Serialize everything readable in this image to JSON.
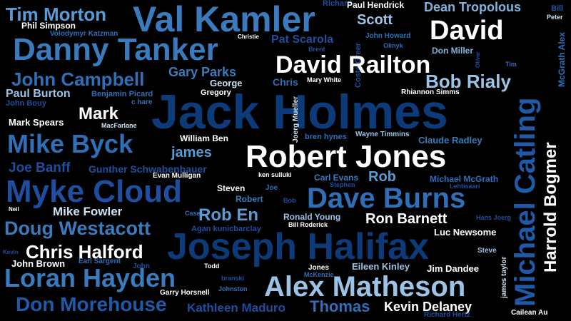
{
  "words": [
    {
      "id": "tim-morton",
      "text": "Tim Morton",
      "color": "#5a9bd5"
    },
    {
      "id": "val-kamler",
      "text": "Val Kamler",
      "color": "#3a7bbd"
    },
    {
      "id": "richard-top",
      "text": "Richard",
      "color": "#1f4e9e"
    },
    {
      "id": "paul-hendrick",
      "text": "Paul Hendrick",
      "color": "#ffffff"
    },
    {
      "id": "dean-tropolous",
      "text": "Dean Tropolous",
      "color": "#7fb4e0"
    },
    {
      "id": "bill-top",
      "text": "Bill",
      "color": "#1f5aa8"
    },
    {
      "id": "peter",
      "text": "Peter",
      "color": "#cfe2f3"
    },
    {
      "id": "phil-simpson",
      "text": "Phil Simpson",
      "color": "#ffffff"
    },
    {
      "id": "volodymyr-katzman",
      "text": "Volodymyr Katzman",
      "color": "#2f6fb8"
    },
    {
      "id": "scott",
      "text": "Scott",
      "color": "#9cc3e6"
    },
    {
      "id": "david",
      "text": "David",
      "color": "#ffffff"
    },
    {
      "id": "danny-tanker",
      "text": "Danny Tanker",
      "color": "#3a7bbd"
    },
    {
      "id": "christie",
      "text": "Christie",
      "color": "#ffffff"
    },
    {
      "id": "pat-scarola",
      "text": "Pat Scarola",
      "color": "#1f4e9e"
    },
    {
      "id": "john-howard",
      "text": "John Howard",
      "color": "#2f6fb8"
    },
    {
      "id": "brent",
      "text": "Brent",
      "color": "#1f4e9e"
    },
    {
      "id": "olinyk",
      "text": "Olinyk",
      "color": "#2f6fb8"
    },
    {
      "id": "don-miller",
      "text": "Don Miller",
      "color": "#7fb4e0"
    },
    {
      "id": "oliver",
      "text": "Oliver",
      "color": "#1f4e9e"
    },
    {
      "id": "costa-greer",
      "text": "Costa Greer",
      "color": "#1f4e9e"
    },
    {
      "id": "mcgrath-alex",
      "text": "McGrath Alex",
      "color": "#2f6fb8"
    },
    {
      "id": "gary-parks",
      "text": "Gary Parks",
      "color": "#3a7bbd"
    },
    {
      "id": "david-railton",
      "text": "David Railton",
      "color": "#ffffff"
    },
    {
      "id": "tim",
      "text": "Tim",
      "color": "#2f6fb8"
    },
    {
      "id": "john-campbell",
      "text": "John Campbell",
      "color": "#2f6fb8"
    },
    {
      "id": "george",
      "text": "George",
      "color": "#cfe2f3"
    },
    {
      "id": "chris-small",
      "text": "Chris",
      "color": "#2f6fb8"
    },
    {
      "id": "mary-white",
      "text": "Mary White",
      "color": "#ffffff"
    },
    {
      "id": "bob-rialy",
      "text": "Bob Rialy",
      "color": "#9cc3e6"
    },
    {
      "id": "paul-burton",
      "text": "Paul Burton",
      "color": "#9cc3e6"
    },
    {
      "id": "benjamin-picard",
      "text": "Benjamin Picard",
      "color": "#2f6fb8"
    },
    {
      "id": "gregory",
      "text": "Gregory",
      "color": "#ffffff"
    },
    {
      "id": "rhiannon-simms",
      "text": "Rhiannon Simms",
      "color": "#ffffff"
    },
    {
      "id": "john-bouy",
      "text": "John Bouy",
      "color": "#1f4e9e"
    },
    {
      "id": "c-hare",
      "text": "c hare",
      "color": "#2f6fb8"
    },
    {
      "id": "jack-holmes",
      "text": "Jack Holmes",
      "color": "#0d3b7a"
    },
    {
      "id": "joerg-mueller",
      "text": "Joerg Mueller",
      "color": "#cfe2f3"
    },
    {
      "id": "michael-catling",
      "text": "Michael Catling",
      "color": "#1f5aa8"
    },
    {
      "id": "harrold-bogmer",
      "text": "Harrold Bogmer",
      "color": "#ffffff"
    },
    {
      "id": "mark",
      "text": "Mark",
      "color": "#ffffff"
    },
    {
      "id": "mark-spears",
      "text": "Mark Spears",
      "color": "#ffffff"
    },
    {
      "id": "macfarlane",
      "text": "MacFarlane",
      "color": "#cfe2f3"
    },
    {
      "id": "bren-hynes",
      "text": "bren hynes",
      "color": "#2f6fb8"
    },
    {
      "id": "wayne-timmins",
      "text": "Wayne Timmins",
      "color": "#9cc3e6"
    },
    {
      "id": "mike-byck",
      "text": "Mike Byck",
      "color": "#2f6fb8"
    },
    {
      "id": "william-ben",
      "text": "William Ben",
      "color": "#ffffff"
    },
    {
      "id": "claude-radley",
      "text": "Claude Radley",
      "color": "#3a7bbd"
    },
    {
      "id": "james",
      "text": "james",
      "color": "#5a9bd5"
    },
    {
      "id": "robert-jones",
      "text": "Robert Jones",
      "color": "#ffffff"
    },
    {
      "id": "joe-banff",
      "text": "Joe Banff",
      "color": "#1f4e9e"
    },
    {
      "id": "gunther-schwabenbauer",
      "text": "Gunther Schwabenbauer",
      "color": "#1f4e9e"
    },
    {
      "id": "evan-mulligan",
      "text": "Evan Mulligan",
      "color": "#ffffff"
    },
    {
      "id": "ken-sulluki",
      "text": "ken sulluki",
      "color": "#ffffff"
    },
    {
      "id": "carl-evans",
      "text": "Carl Evans",
      "color": "#3a7bbd"
    },
    {
      "id": "rob",
      "text": "Rob",
      "color": "#5a9bd5"
    },
    {
      "id": "michael-mcgrath",
      "text": "Michael McGrath",
      "color": "#2f6fb8"
    },
    {
      "id": "stephen",
      "text": "Stephen",
      "color": "#1f4e9e"
    },
    {
      "id": "lehtisaari",
      "text": "Lehtisaari",
      "color": "#1f4e9e"
    },
    {
      "id": "myke-cloud",
      "text": "Myke Cloud",
      "color": "#1f4e9e"
    },
    {
      "id": "steven",
      "text": "Steven",
      "color": "#ffffff"
    },
    {
      "id": "joe",
      "text": "Joe",
      "color": "#2f6fb8"
    },
    {
      "id": "robert-small",
      "text": "Robert",
      "color": "#3a7bbd"
    },
    {
      "id": "bob-small",
      "text": "Bob",
      "color": "#1f4e9e"
    },
    {
      "id": "dave-burns",
      "text": "Dave Burns",
      "color": "#2f6fb8"
    },
    {
      "id": "neil",
      "text": "Neil",
      "color": "#ffffff"
    },
    {
      "id": "mike-fowler",
      "text": "Mike Fowler",
      "color": "#cfe2f3"
    },
    {
      "id": "casey",
      "text": "Casey",
      "color": "#2f6fb8"
    },
    {
      "id": "rob-en",
      "text": "Rob En",
      "color": "#5a9bd5"
    },
    {
      "id": "ronald-young",
      "text": "Ronald Young",
      "color": "#9cc3e6"
    },
    {
      "id": "ron-barnett",
      "text": "Ron Barnett",
      "color": "#ffffff"
    },
    {
      "id": "hans-joerg",
      "text": "Hans Joerg",
      "color": "#1f4e9e"
    },
    {
      "id": "bill-roderick",
      "text": "Bill Roderick",
      "color": "#ffffff"
    },
    {
      "id": "doug-westacott",
      "text": "Doug Westacott",
      "color": "#3a7bbd"
    },
    {
      "id": "agan-kunicbarclay",
      "text": "Agan kunicbarclay",
      "color": "#1f4e9e"
    },
    {
      "id": "luc-newsome",
      "text": "Luc Newsome",
      "color": "#ffffff"
    },
    {
      "id": "chris-halford",
      "text": "Chris Halford",
      "color": "#ffffff"
    },
    {
      "id": "joseph-halifax",
      "text": "Joseph Halifax",
      "color": "#0d3b7a"
    },
    {
      "id": "kevin-small",
      "text": "Kevin",
      "color": "#1f4e9e"
    },
    {
      "id": "steve",
      "text": "Steve",
      "color": "#9cc3e6"
    },
    {
      "id": "john-brown",
      "text": "John Brown",
      "color": "#ffffff"
    },
    {
      "id": "earl-sargent",
      "text": "Earl Sargent",
      "color": "#2f6fb8"
    },
    {
      "id": "james-taylor",
      "text": "james taylor",
      "color": "#cfe2f3"
    },
    {
      "id": "loran-hayden",
      "text": "Loran Hayden",
      "color": "#3a7bbd"
    },
    {
      "id": "john-small",
      "text": "John",
      "color": "#1f4e9e"
    },
    {
      "id": "todd",
      "text": "Todd",
      "color": "#ffffff"
    },
    {
      "id": "jones",
      "text": "Jones",
      "color": "#ffffff"
    },
    {
      "id": "mckenzie",
      "text": "McKenzie",
      "color": "#2f6fb8"
    },
    {
      "id": "eileen-kinley",
      "text": "Eileen Kinley",
      "color": "#9cc3e6"
    },
    {
      "id": "jim-dandee",
      "text": "Jim Dandee",
      "color": "#ffffff"
    },
    {
      "id": "branski",
      "text": "branski",
      "color": "#1f4e9e"
    },
    {
      "id": "johnston",
      "text": "Johnston",
      "color": "#2f6fb8"
    },
    {
      "id": "garry-horsnell",
      "text": "Garry Horsnell",
      "color": "#ffffff"
    },
    {
      "id": "alex-matheson",
      "text": "Alex Matheson",
      "color": "#9cc3e6"
    },
    {
      "id": "don-morehouse",
      "text": "Don Morehouse",
      "color": "#1f5aa8"
    },
    {
      "id": "kathleen-maduro",
      "text": "Kathleen Maduro",
      "color": "#1f4e9e"
    },
    {
      "id": "thomas",
      "text": "Thomas",
      "color": "#2f6fb8"
    },
    {
      "id": "kevin-delaney",
      "text": "Kevin Delaney",
      "color": "#ffffff"
    },
    {
      "id": "richard-hertz",
      "text": "Richard Hertz",
      "color": "#1f4e9e"
    },
    {
      "id": "cailean-au",
      "text": "Cailean Au",
      "color": "#ffffff"
    }
  ]
}
